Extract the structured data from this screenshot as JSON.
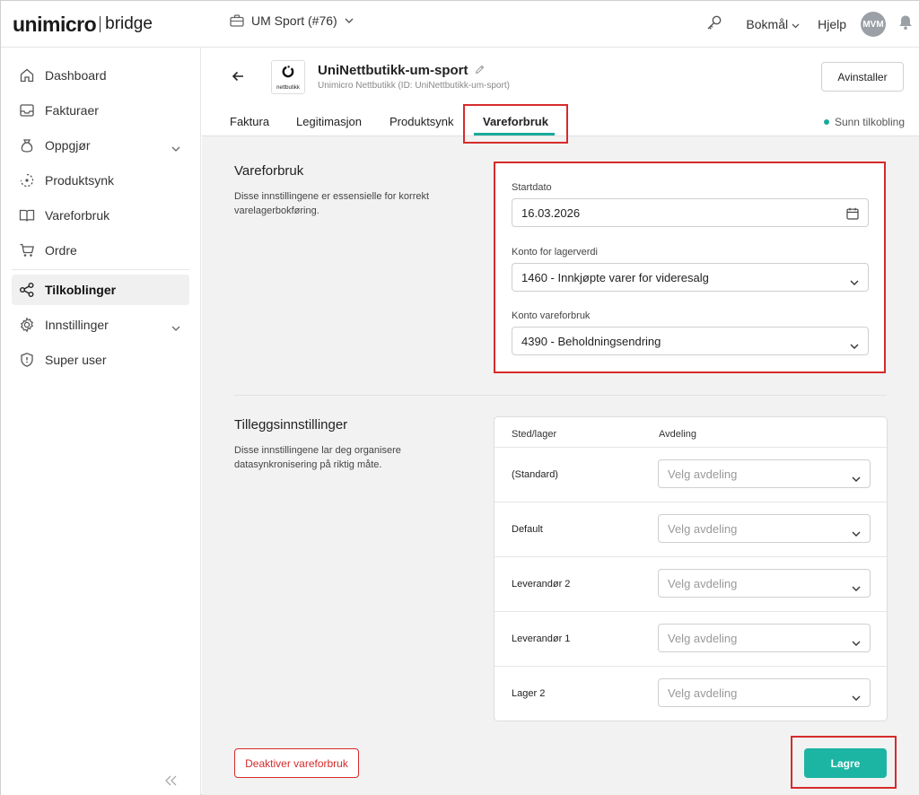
{
  "brand": {
    "name": "unimicro",
    "product": "bridge"
  },
  "header": {
    "company": "UM Sport (#76)",
    "language": "Bokmål",
    "help": "Hjelp",
    "avatar_initials": "MVM"
  },
  "sidebar": {
    "items": [
      {
        "label": "Dashboard",
        "icon": "home-icon"
      },
      {
        "label": "Fakturaer",
        "icon": "inbox-icon"
      },
      {
        "label": "Oppgjør",
        "icon": "money-icon",
        "expandable": true
      },
      {
        "label": "Produktsynk",
        "icon": "sync-icon"
      },
      {
        "label": "Vareforbruk",
        "icon": "book-icon"
      },
      {
        "label": "Ordre",
        "icon": "cart-icon"
      },
      {
        "label": "Tilkoblinger",
        "icon": "share-icon",
        "active": true
      },
      {
        "label": "Innstillinger",
        "icon": "gear-icon",
        "expandable": true
      },
      {
        "label": "Super user",
        "icon": "shield-icon"
      }
    ]
  },
  "app": {
    "title": "UniNettbutikk-um-sport",
    "subtitle": "Unimicro Nettbutikk (ID: UniNettbutikk-um-sport)",
    "logo_text": "nettbutikk",
    "uninstall_label": "Avinstaller"
  },
  "tabs": [
    "Faktura",
    "Legitimasjon",
    "Produktsynk",
    "Vareforbruk"
  ],
  "active_tab": "Vareforbruk",
  "connection_status": "Sunn tilkobling",
  "vareforbruk": {
    "title": "Vareforbruk",
    "description": "Disse innstillingene er essensielle for korrekt varelagerbokføring.",
    "start_label": "Startdato",
    "start_value": "16.03.2026",
    "stock_account_label": "Konto for lagerverdi",
    "stock_account_value": "1460 - Innkjøpte varer for videresalg",
    "consumption_account_label": "Konto vareforbruk",
    "consumption_account_value": "4390 - Beholdningsendring"
  },
  "additional": {
    "title": "Tilleggsinnstillinger",
    "description": "Disse innstillingene lar deg organisere datasynkronisering på riktig måte.",
    "col_location": "Sted/lager",
    "col_department": "Avdeling",
    "select_placeholder": "Velg avdeling",
    "rows": [
      "(Standard)",
      "Default",
      "Leverandør 2",
      "Leverandør 1",
      "Lager 2"
    ]
  },
  "footer": {
    "deactivate_label": "Deaktiver vareforbruk",
    "save_label": "Lagre"
  },
  "colors": {
    "accent": "#1cb5a3",
    "highlight": "#d62b2b",
    "danger": "#d62b2b"
  }
}
